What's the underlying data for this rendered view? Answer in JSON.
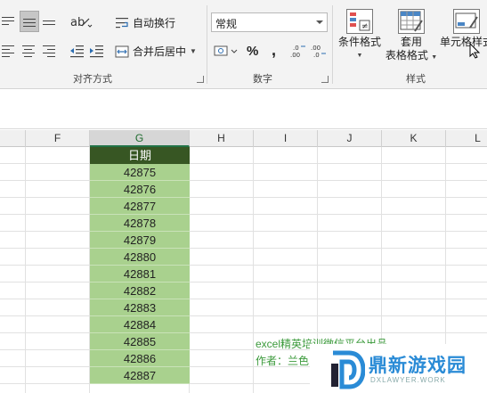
{
  "ribbon": {
    "alignment_group": {
      "label": "对齐方式",
      "wrap_text": "自动换行",
      "merge_center": "合并后居中"
    },
    "number_group": {
      "label": "数字",
      "format_value": "常规",
      "percent_symbol": "%",
      "comma_symbol": ","
    },
    "styles_group": {
      "label": "样式",
      "conditional_format": "条件格式",
      "format_as_table_line1": "套用",
      "format_as_table_line2": "表格格式",
      "cell_styles": "单元格样式"
    }
  },
  "columns": [
    "F",
    "G",
    "H",
    "I",
    "J",
    "K",
    "L"
  ],
  "sheet": {
    "header": "日期",
    "values": [
      "42875",
      "42876",
      "42877",
      "42878",
      "42879",
      "42880",
      "42881",
      "42882",
      "42883",
      "42884",
      "42885",
      "42886",
      "42887"
    ]
  },
  "watermark": {
    "line1": "excel精英培训微信平台出品",
    "line2": "作者：兰色"
  },
  "logo": {
    "title": "鼎新游戏园",
    "subtitle": "DXLAWYER.WORK"
  },
  "colors": {
    "header_fill": "#375623",
    "data_fill": "#a9d18e",
    "watermark_green": "#3b9a3b",
    "logo_blue": "#2a8bd6"
  }
}
